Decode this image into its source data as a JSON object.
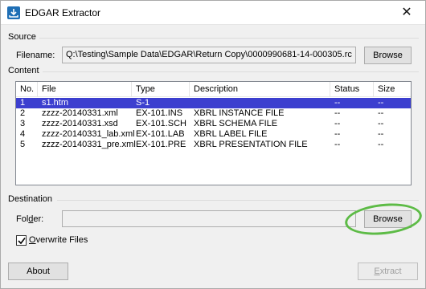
{
  "window": {
    "title": "EDGAR Extractor",
    "close_glyph": "✕"
  },
  "source": {
    "group_label": "Source",
    "filename_label": "Filename:",
    "filename_value": "Q:\\Testing\\Sample Data\\EDGAR\\Return Copy\\0000990681-14-000305.rc",
    "browse_label": "Browse"
  },
  "content": {
    "group_label": "Content",
    "columns": [
      "No.",
      "File",
      "Type",
      "Description",
      "Status",
      "Size"
    ],
    "rows": [
      {
        "no": "1",
        "file": "s1.htm",
        "type": "S-1",
        "description": "",
        "status": "--",
        "size": "--",
        "selected": true
      },
      {
        "no": "2",
        "file": "zzzz-20140331.xml",
        "type": "EX-101.INS",
        "description": "XBRL INSTANCE FILE",
        "status": "--",
        "size": "--"
      },
      {
        "no": "3",
        "file": "zzzz-20140331.xsd",
        "type": "EX-101.SCH",
        "description": "XBRL SCHEMA FILE",
        "status": "--",
        "size": "--"
      },
      {
        "no": "4",
        "file": "zzzz-20140331_lab.xml",
        "type": "EX-101.LAB",
        "description": "XBRL LABEL FILE",
        "status": "--",
        "size": "--"
      },
      {
        "no": "5",
        "file": "zzzz-20140331_pre.xml",
        "type": "EX-101.PRE",
        "description": "XBRL PRESENTATION FILE",
        "status": "--",
        "size": "--"
      }
    ]
  },
  "destination": {
    "group_label": "Destination",
    "folder_label_pre": "Fol",
    "folder_label_ul": "d",
    "folder_label_post": "er:",
    "folder_value": "",
    "browse_label": "Browse",
    "overwrite_label_ul": "O",
    "overwrite_label_rest": "verwrite Files",
    "overwrite_checked": true
  },
  "footer": {
    "about_label": "About",
    "extract_label_ul": "E",
    "extract_label_rest": "xtract"
  },
  "colors": {
    "selection": "#3c3fcf",
    "annotation_ring": "#5dbb46",
    "app_icon": "#1f6fb5"
  }
}
